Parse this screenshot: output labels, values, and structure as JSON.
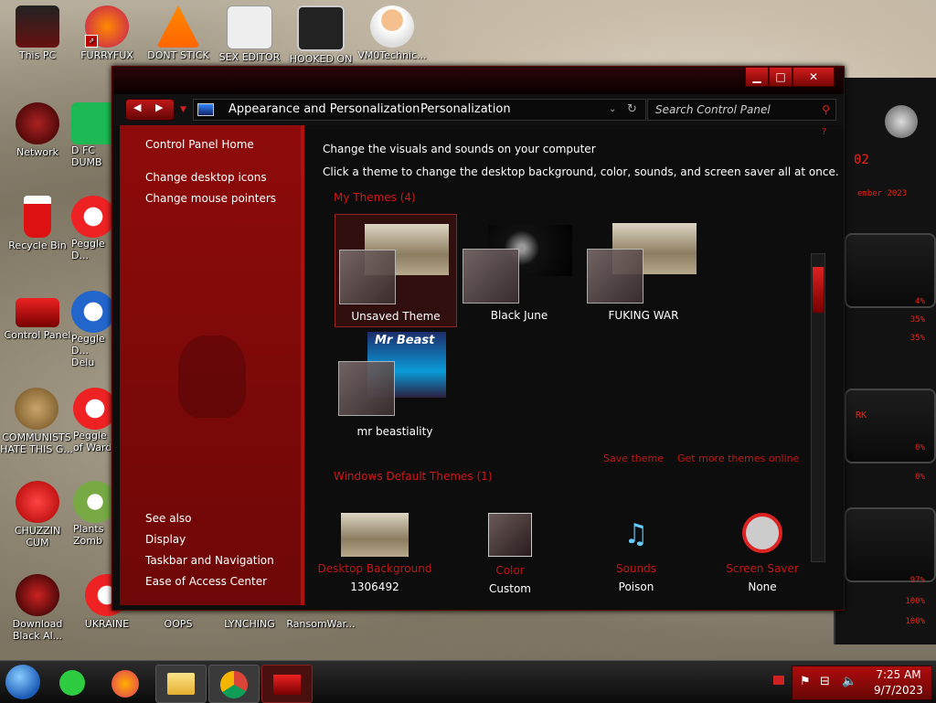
{
  "desktop": {
    "icons": [
      {
        "label": "This PC"
      },
      {
        "label": "FURRYFUX"
      },
      {
        "label": "DONT STICK"
      },
      {
        "label": "SEX EDITOR"
      },
      {
        "label": "HOOKED ON"
      },
      {
        "label": "VM0Technic..."
      },
      {
        "label": "Network"
      },
      {
        "label": "D FC DUMB"
      },
      {
        "label": "Recycle Bin"
      },
      {
        "label": "Peggle D..."
      },
      {
        "label": "Control Panel"
      },
      {
        "label": "Peggle D... Delu"
      },
      {
        "label": "COMMUNISTS HATE THIS G..."
      },
      {
        "label": "Peggle of Ward"
      },
      {
        "label": "CHUZZIN CUM"
      },
      {
        "label": "Plants Zomb"
      },
      {
        "label": "Download Black Al..."
      },
      {
        "label": "UKRAINE"
      },
      {
        "label": "OOPS"
      },
      {
        "label": "LYNCHING"
      },
      {
        "label": "RansomWar..."
      }
    ]
  },
  "gadget": {
    "values": [
      "02",
      "4%",
      "35%",
      "35%",
      "0%",
      "0%",
      "97%",
      "100%",
      "100%"
    ],
    "labels": [
      "ember 2023",
      "RK"
    ]
  },
  "window": {
    "breadcrumb": [
      "Appearance and Personalization",
      "Personalization"
    ],
    "search_placeholder": "Search Control Panel",
    "buttons": {
      "minimize": "▁",
      "maximize": "□",
      "close": "✕"
    },
    "sidebar": {
      "home": "Control Panel Home",
      "links": [
        "Change desktop icons",
        "Change mouse pointers"
      ],
      "see_also_title": "See also",
      "see_also": [
        "Display",
        "Taskbar and Navigation",
        "Ease of Access Center"
      ]
    },
    "content": {
      "heading": "Change the visuals and sounds on your computer",
      "subheading": "Click a theme to change the desktop background, color, sounds, and screen saver all at once.",
      "my_themes_title": "My Themes (4)",
      "themes": [
        {
          "name": "Unsaved Theme",
          "selected": true
        },
        {
          "name": "Black June",
          "selected": false
        },
        {
          "name": "FUKING WAR",
          "selected": false
        },
        {
          "name": "mr beastiality",
          "selected": false
        }
      ],
      "mr_beast_text": "Mr Beast",
      "save_theme": "Save theme",
      "get_more": "Get more themes online",
      "default_themes_title": "Windows Default Themes (1)",
      "bottom": [
        {
          "title": "Desktop Background",
          "value": "1306492"
        },
        {
          "title": "Color",
          "value": "Custom"
        },
        {
          "title": "Sounds",
          "value": "Poison"
        },
        {
          "title": "Screen Saver",
          "value": "None"
        }
      ]
    }
  },
  "taskbar": {
    "time": "7:25 AM",
    "date": "9/7/2023"
  },
  "colors": {
    "accent": "#b01010",
    "text": "#ffffff"
  }
}
